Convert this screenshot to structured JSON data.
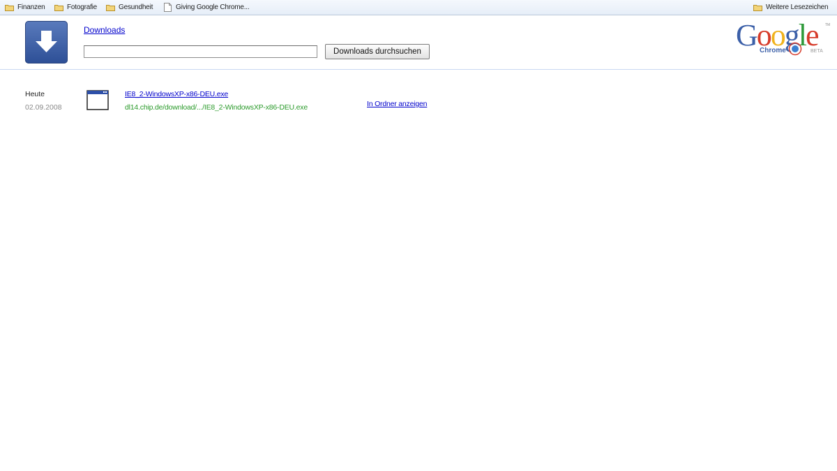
{
  "bookmarks": {
    "items": [
      {
        "label": "Finanzen",
        "icon": "folder-icon"
      },
      {
        "label": "Fotografie",
        "icon": "folder-icon"
      },
      {
        "label": "Gesundheit",
        "icon": "folder-icon"
      },
      {
        "label": "Giving Google Chrome...",
        "icon": "page-icon"
      }
    ],
    "other_label": "Weitere Lesezeichen"
  },
  "header": {
    "title": "Downloads",
    "search_value": "",
    "search_button": "Downloads durchsuchen",
    "logo": {
      "brand": "Google",
      "product": "Chrome",
      "badge": "BETA"
    }
  },
  "downloads": {
    "date_label": "Heute",
    "date_value": "02.09.2008",
    "items": [
      {
        "file_name": "IE8_2-WindowsXP-x86-DEU.exe",
        "url": "dl14.chip.de/download/.../IE8_2-WindowsXP-x86-DEU.exe",
        "action": "In Ordner anzeigen"
      }
    ]
  },
  "colors": {
    "link": "#0000cc",
    "url_green": "#2a9a2a",
    "logo_blue": "#3b5fa8"
  }
}
